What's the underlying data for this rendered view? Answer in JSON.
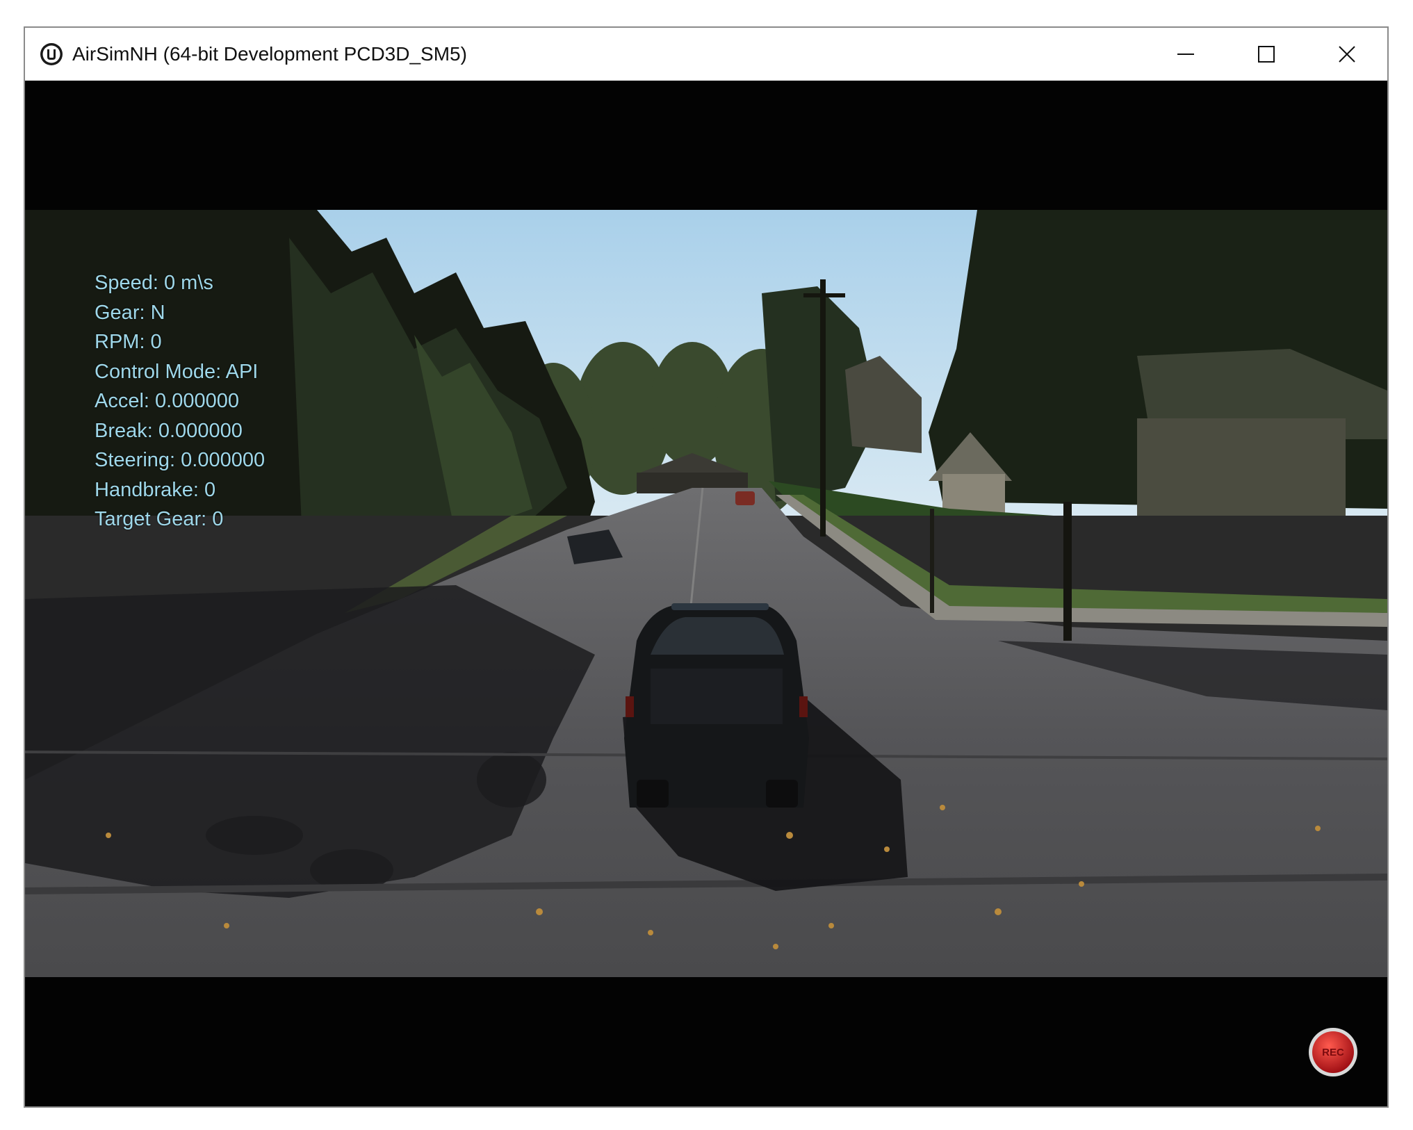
{
  "window": {
    "title": "AirSimNH (64-bit Development PCD3D_SM5)",
    "app_icon": "unreal-engine-icon",
    "controls": [
      "minimize-icon",
      "maximize-icon",
      "close-icon"
    ]
  },
  "hud": {
    "speed": "Speed: 0 m\\s",
    "gear": "Gear: N",
    "rpm": "RPM: 0",
    "control_mode": "Control Mode: API",
    "accel": "Accel: 0.000000",
    "break": "Break: 0.000000",
    "steering": "Steering: 0.000000",
    "handbrake": "Handbrake: 0",
    "target_gear": "Target Gear: 0"
  },
  "record_button": {
    "label": "REC",
    "color": "#c4141c"
  },
  "colors": {
    "hud_text": "#9fd8ea",
    "letterbox": "#030303"
  }
}
